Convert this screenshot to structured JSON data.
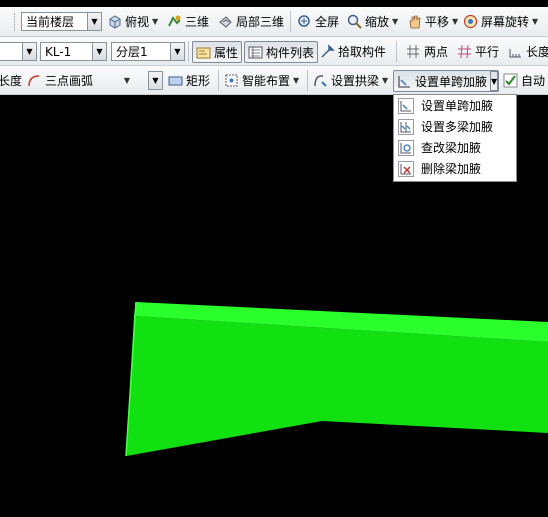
{
  "toolbar1": {
    "floor_combo": "当前楼层",
    "top_view": "俯视",
    "three_d": "三维",
    "partial_3d": "局部三维",
    "full_screen": "全屏",
    "zoom": "缩放",
    "pan": "平移",
    "screen_rotate": "屏幕旋转"
  },
  "toolbar2": {
    "member_combo": "KL-1",
    "layer_combo": "分层1",
    "properties": "属性",
    "member_list": "构件列表",
    "pick_member": "拾取构件",
    "two_points": "两点",
    "parallel": "平行",
    "length_cut": "长度"
  },
  "toolbar3": {
    "length_label": "长度",
    "three_point_arc": "三点画弧",
    "rectangle": "矩形",
    "smart_layout": "智能布置",
    "set_arch_beam": "设置拱梁",
    "set_single_span_haunch": "设置单跨加腋",
    "auto": "自动"
  },
  "menu": {
    "items": [
      "设置单跨加腋",
      "设置多梁加腋",
      "查改梁加腋",
      "删除梁加腋"
    ]
  },
  "colors": {
    "beam_top": "#2bff2b",
    "beam_face": "#11e011",
    "background": "#000000"
  }
}
